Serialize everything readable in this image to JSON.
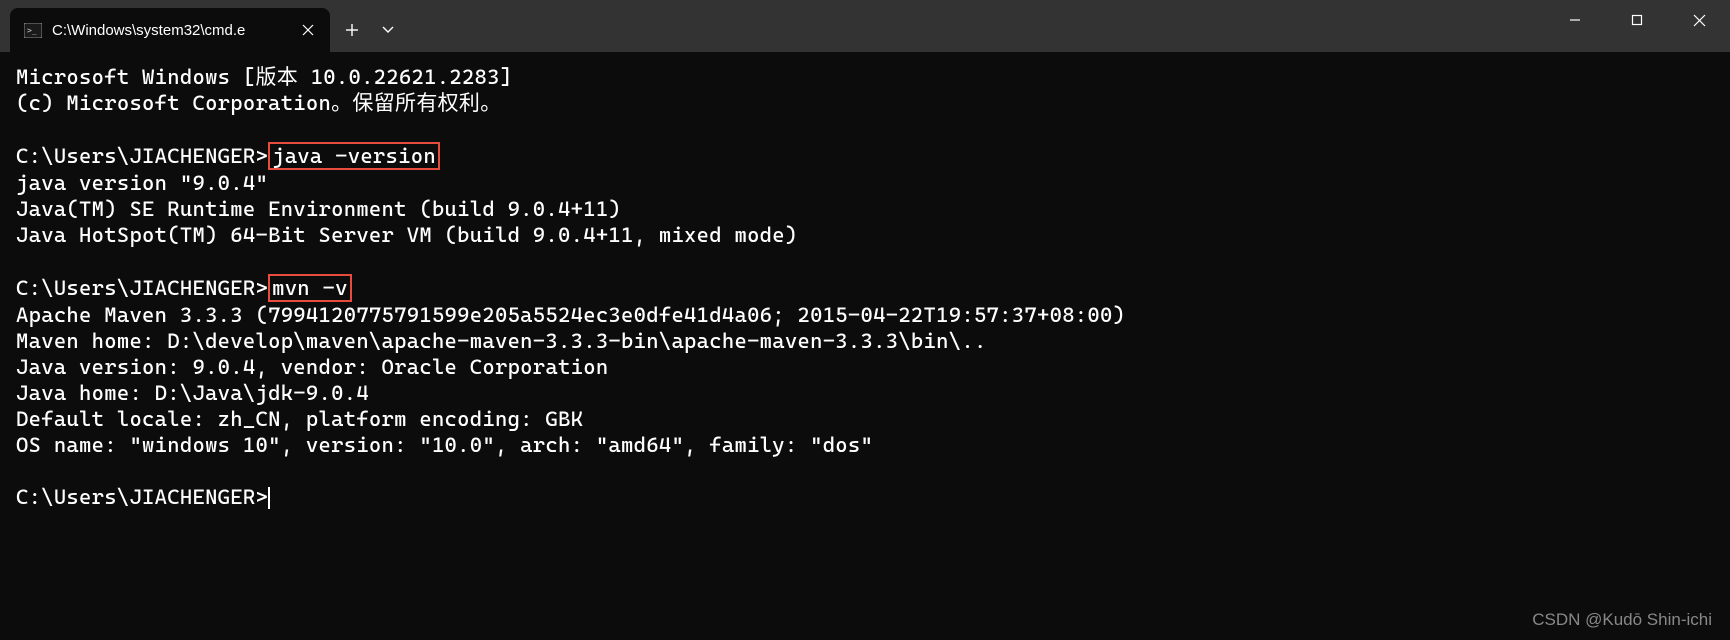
{
  "titlebar": {
    "tab_title": "C:\\Windows\\system32\\cmd.e"
  },
  "terminal": {
    "line1": "Microsoft Windows [版本 10.0.22621.2283]",
    "line2": "(c) Microsoft Corporation。保留所有权利。",
    "prompt1_prefix": "C:\\Users\\JIACHENGER>",
    "cmd1": "java -version",
    "java_out1": "java version \"9.0.4\"",
    "java_out2": "Java(TM) SE Runtime Environment (build 9.0.4+11)",
    "java_out3": "Java HotSpot(TM) 64-Bit Server VM (build 9.0.4+11, mixed mode)",
    "prompt2_prefix": "C:\\Users\\JIACHENGER>",
    "cmd2": "mvn -v",
    "mvn_out1": "Apache Maven 3.3.3 (7994120775791599e205a5524ec3e0dfe41d4a06; 2015-04-22T19:57:37+08:00)",
    "mvn_out2": "Maven home: D:\\develop\\maven\\apache-maven-3.3.3-bin\\apache-maven-3.3.3\\bin\\..",
    "mvn_out3": "Java version: 9.0.4, vendor: Oracle Corporation",
    "mvn_out4": "Java home: D:\\Java\\jdk-9.0.4",
    "mvn_out5": "Default locale: zh_CN, platform encoding: GBK",
    "mvn_out6": "OS name: \"windows 10\", version: \"10.0\", arch: \"amd64\", family: \"dos\"",
    "prompt3": "C:\\Users\\JIACHENGER>"
  },
  "watermark": "CSDN @Kudō Shin-ichi"
}
